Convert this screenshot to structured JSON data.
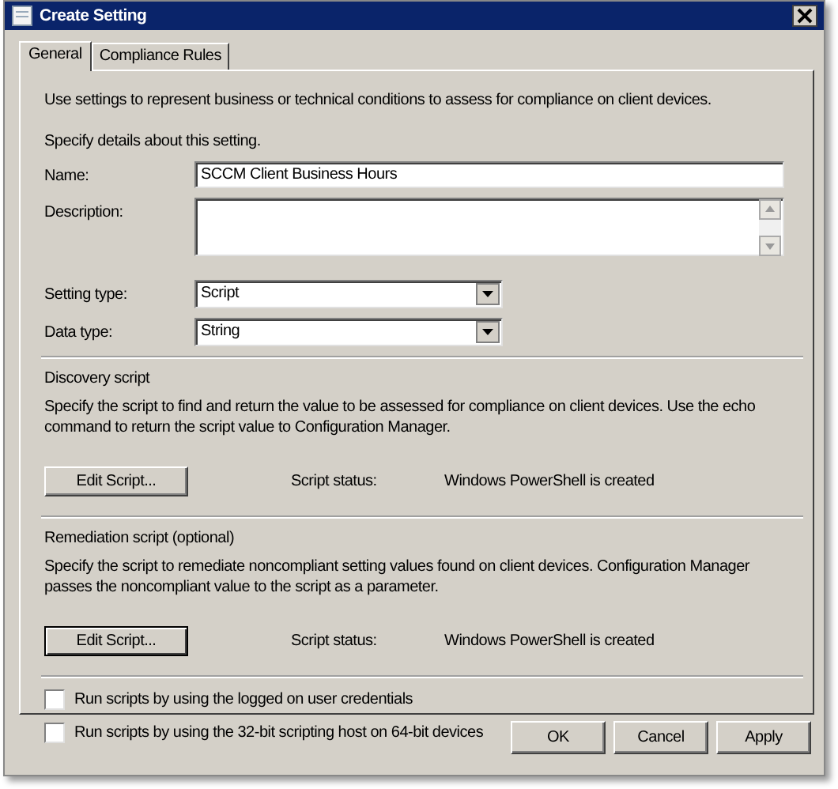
{
  "window": {
    "title": "Create Setting"
  },
  "tabs": [
    {
      "label": "General",
      "selected": true
    },
    {
      "label": "Compliance Rules",
      "selected": false
    }
  ],
  "intro": "Use settings to represent business or technical conditions to assess for compliance on client devices.",
  "details_heading": "Specify details about this setting.",
  "fields": [
    {
      "kind": "text",
      "label": "Name:",
      "value": "SCCM Client Business Hours"
    },
    {
      "kind": "textarea",
      "label": "Description:"
    },
    {
      "kind": "dropdown",
      "label": "Setting type:",
      "value": "Script"
    },
    {
      "kind": "dropdown",
      "label": "Data type:",
      "value": "String"
    }
  ],
  "scripts": [
    {
      "heading": "Discovery script",
      "description": "Specify the script to find and return the value to be assessed for compliance on client devices. Use the echo command to return the script value to Configuration Manager.",
      "button": "Edit Script...",
      "focused": false,
      "status_label": "Script status:",
      "status": "Windows PowerShell is created"
    },
    {
      "heading": "Remediation script (optional)",
      "description": "Specify the script to remediate noncompliant setting values found on client devices. Configuration Manager passes the noncompliant value to the script as a parameter.",
      "button": "Edit Script...",
      "focused": true,
      "status_label": "Script status:",
      "status": "Windows PowerShell is created"
    }
  ],
  "options": [
    {
      "label": "Run scripts by using the logged on user credentials",
      "checked": false
    },
    {
      "label": "Run scripts by using the 32-bit scripting host on 64-bit devices",
      "checked": false
    }
  ],
  "buttons": [
    "OK",
    "Cancel",
    "Apply"
  ]
}
